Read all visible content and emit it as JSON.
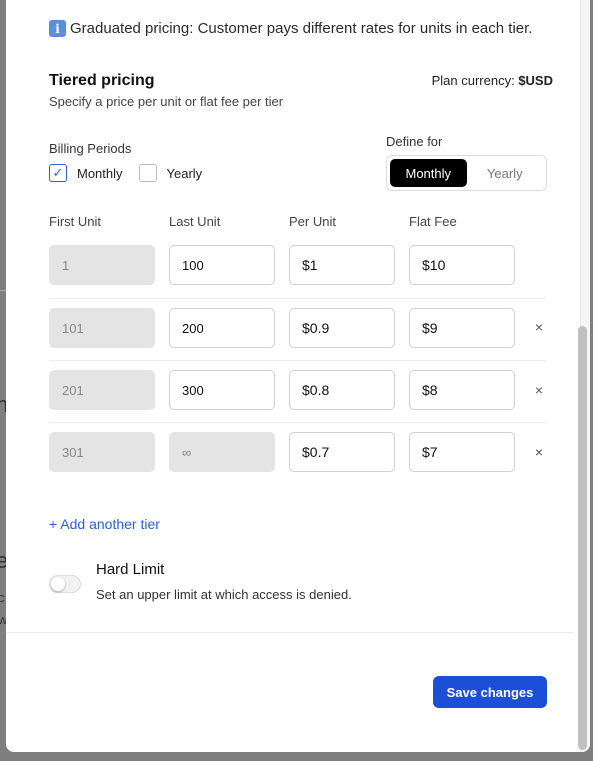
{
  "background": {
    "fragments": [
      "i",
      "n",
      "e",
      "c",
      "w"
    ]
  },
  "info": {
    "icon": "info-icon",
    "text": "Graduated pricing: Customer pays different rates for units in each tier."
  },
  "section": {
    "title": "Tiered pricing",
    "subtitle": "Specify a price per unit or flat fee per tier",
    "currency_label": "Plan currency:",
    "currency_value": "$USD"
  },
  "billing_periods": {
    "label": "Billing Periods",
    "options": [
      {
        "label": "Monthly",
        "checked": true
      },
      {
        "label": "Yearly",
        "checked": false
      }
    ]
  },
  "define_for": {
    "label": "Define for",
    "options": [
      "Monthly",
      "Yearly"
    ],
    "selected": "Monthly"
  },
  "columns": [
    "First Unit",
    "Last Unit",
    "Per Unit",
    "Flat Fee"
  ],
  "tiers": [
    {
      "first": "1",
      "last": "100",
      "per_unit": "$1",
      "flat_fee": "$10",
      "removable": false
    },
    {
      "first": "101",
      "last": "200",
      "per_unit": "$0.9",
      "flat_fee": "$9",
      "removable": true
    },
    {
      "first": "201",
      "last": "300",
      "per_unit": "$0.8",
      "flat_fee": "$8",
      "removable": true
    },
    {
      "first": "301",
      "last": "∞",
      "per_unit": "$0.7",
      "flat_fee": "$7",
      "removable": true
    }
  ],
  "remove_glyph": "×",
  "add_tier_label": "+ Add another tier",
  "hard_limit": {
    "title": "Hard Limit",
    "description": "Set an upper limit at which access is denied.",
    "enabled": false
  },
  "save_label": "Save changes",
  "colors": {
    "accent": "#1d4ed8",
    "link": "#2b5fd9",
    "segment_active": "#000000"
  }
}
